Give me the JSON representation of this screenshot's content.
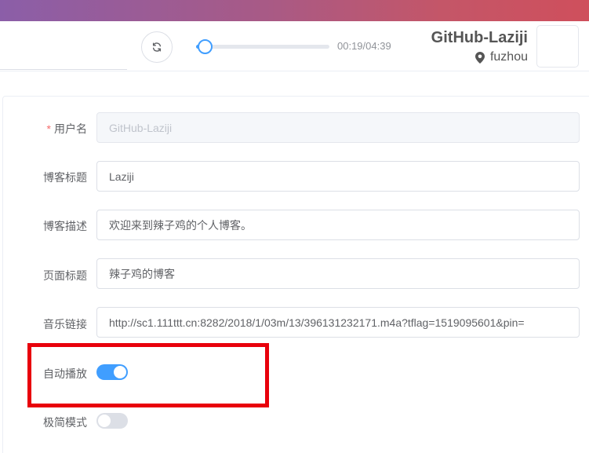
{
  "player": {
    "current_time": "00:19",
    "duration": "04:39",
    "time_display": "00:19/04:39",
    "progress": 0.07,
    "accent_color": "#409eff"
  },
  "user": {
    "name": "GitHub-Laziji",
    "location": "fuzhou"
  },
  "form": {
    "username": {
      "label": "用户名",
      "required_mark": "*",
      "value": "GitHub-Laziji",
      "disabled": true
    },
    "blog_title": {
      "label": "博客标题",
      "value": "Laziji"
    },
    "blog_desc": {
      "label": "博客描述",
      "value": "欢迎来到辣子鸡的个人博客。"
    },
    "page_title": {
      "label": "页面标题",
      "value": "辣子鸡的博客"
    },
    "music_link": {
      "label": "音乐链接",
      "value": "http://sc1.111ttt.cn:8282/2018/1/03m/13/396131232171.m4a?tflag=1519095601&pin="
    },
    "autoplay": {
      "label": "自动播放",
      "on": true
    },
    "minimal_mode": {
      "label": "极简模式",
      "on": false
    }
  },
  "colors": {
    "switch_on": "#409eff",
    "switch_off": "#dcdfe6",
    "required": "#f56c6c",
    "highlight": "#e8000b"
  },
  "icons": {
    "refresh": "refresh-icon",
    "location": "location-pin-icon"
  }
}
